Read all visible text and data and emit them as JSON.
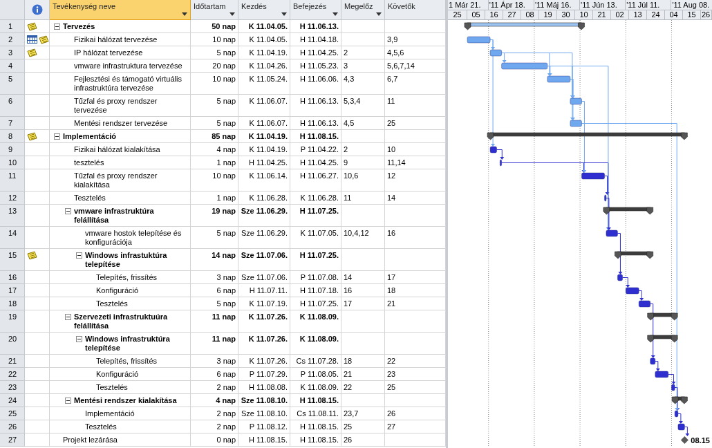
{
  "columns": [
    {
      "label": "Tevékenység neve",
      "selected": true,
      "menu": true
    },
    {
      "label": "Időtartam",
      "selected": false,
      "menu": true
    },
    {
      "label": "Kezdés",
      "selected": false,
      "menu": true
    },
    {
      "label": "Befejezés",
      "selected": false,
      "menu": true
    },
    {
      "label": "Megelőz",
      "selected": false,
      "menu": true
    },
    {
      "label": "Követők",
      "selected": false,
      "menu": false
    }
  ],
  "timescale": {
    "major": [
      "1 Már 21.",
      "'11 Ápr 18.",
      "'11 Máj 16.",
      "'11 Jún 13.",
      "'11 Júl 11.",
      "'11 Aug 08."
    ],
    "minor": [
      "25",
      "05",
      "16",
      "27",
      "08",
      "19",
      "30",
      "10",
      "21",
      "02",
      "13",
      "24",
      "04",
      "15",
      "26"
    ]
  },
  "tasks": [
    {
      "id": "1",
      "kind": "summary",
      "expanded": true,
      "indicators": [
        {
          "kind": "note"
        }
      ],
      "name": "Tervezés",
      "duration": "50 nap",
      "start": "K 11.04.05.",
      "finish": "H 11.06.13.",
      "color": "#9cc4f2",
      "children": [
        {
          "id": "2",
          "kind": "task",
          "indicators": [
            {
              "kind": "calendar"
            },
            {
              "kind": "note"
            }
          ],
          "name": "Fizikai hálózat tervezése",
          "duration": "10 nap",
          "start": "K 11.04.05.",
          "finish": "H 11.04.18.",
          "successors": "3,9",
          "color": "#6fa8ef"
        },
        {
          "id": "3",
          "kind": "task",
          "indicators": [
            {
              "kind": "note"
            }
          ],
          "name": "IP hálózat tervezése",
          "duration": "5 nap",
          "start": "K 11.04.19.",
          "finish": "H 11.04.25.",
          "predecessors": "2",
          "successors": "4,5,6",
          "color": "#6fa8ef"
        },
        {
          "id": "4",
          "kind": "task",
          "name": "vmware infrastruktura tervezése",
          "duration": "20 nap",
          "start": "K 11.04.26.",
          "finish": "H 11.05.23.",
          "predecessors": "3",
          "successors": "5,6,7,14",
          "color": "#6fa8ef"
        },
        {
          "id": "5",
          "kind": "task",
          "name": "Fejlesztési és támogató virtuális infrastruktúra tervezése",
          "duration": "10 nap",
          "start": "K 11.05.24.",
          "finish": "H 11.06.06.",
          "predecessors": "4,3",
          "successors": "6,7",
          "color": "#6fa8ef"
        },
        {
          "id": "6",
          "kind": "task",
          "name": "Tűzfal és proxy rendszer tervezése",
          "duration": "5 nap",
          "start": "K 11.06.07.",
          "finish": "H 11.06.13.",
          "predecessors": "5,3,4",
          "successors": "11",
          "color": "#6fa8ef"
        },
        {
          "id": "7",
          "kind": "task",
          "name": "Mentési rendszer tervezése",
          "duration": "5 nap",
          "start": "K 11.06.07.",
          "finish": "H 11.06.13.",
          "predecessors": "4,5",
          "successors": "25",
          "color": "#6fa8ef"
        }
      ]
    },
    {
      "id": "8",
      "kind": "summary",
      "expanded": true,
      "indicators": [
        {
          "kind": "note"
        }
      ],
      "name": "Implementáció",
      "duration": "85 nap",
      "start": "K 11.04.19.",
      "finish": "H 11.08.15.",
      "color": "#3c3c3c",
      "children": [
        {
          "id": "9",
          "kind": "task",
          "name": "Fizikai hálózat kialakítása",
          "duration": "4 nap",
          "start": "K 11.04.19.",
          "finish": "P 11.04.22.",
          "predecessors": "2",
          "successors": "10",
          "color": "#2f2fd0"
        },
        {
          "id": "10",
          "kind": "task",
          "name": "tesztelés",
          "duration": "1 nap",
          "start": "H 11.04.25.",
          "finish": "H 11.04.25.",
          "predecessors": "9",
          "successors": "11,14",
          "color": "#2f2fd0"
        },
        {
          "id": "11",
          "kind": "task",
          "name": "Tűzfal és proxy rendszer kialakítása",
          "duration": "10 nap",
          "start": "K 11.06.14.",
          "finish": "H 11.06.27.",
          "predecessors": "10,6",
          "successors": "12",
          "color": "#2f2fd0"
        },
        {
          "id": "12",
          "kind": "task",
          "name": "Tesztelés",
          "duration": "1 nap",
          "start": "K 11.06.28.",
          "finish": "K 11.06.28.",
          "predecessors": "11",
          "successors": "14",
          "color": "#2f2fd0"
        },
        {
          "id": "13",
          "kind": "summary",
          "expanded": true,
          "name": "vmware infrastruktúra felállítása",
          "duration": "19 nap",
          "start": "Sze 11.06.29.",
          "finish": "H 11.07.25.",
          "color": "#3c3c3c",
          "children": [
            {
              "id": "14",
              "kind": "task",
              "name": "vmware hostok telepítése és konfigurációja",
              "duration": "5 nap",
              "start": "Sze 11.06.29.",
              "finish": "K 11.07.05.",
              "predecessors": "10,4,12",
              "successors": "16",
              "color": "#2f2fd0"
            },
            {
              "id": "15",
              "kind": "summary",
              "expanded": true,
              "indicators": [
                {
                  "kind": "note"
                }
              ],
              "name": "Windows infrastuktúra telepítése",
              "duration": "14 nap",
              "start": "Sze 11.07.06.",
              "finish": "H 11.07.25.",
              "color": "#3c3c3c",
              "children": [
                {
                  "id": "16",
                  "kind": "task",
                  "name": "Telepítés, frissítés",
                  "duration": "3 nap",
                  "start": "Sze 11.07.06.",
                  "finish": "P 11.07.08.",
                  "predecessors": "14",
                  "successors": "17",
                  "color": "#2f2fd0"
                },
                {
                  "id": "17",
                  "kind": "task",
                  "name": "Konfiguráció",
                  "duration": "6 nap",
                  "start": "H 11.07.11.",
                  "finish": "H 11.07.18.",
                  "predecessors": "16",
                  "successors": "18",
                  "color": "#2f2fd0"
                },
                {
                  "id": "18",
                  "kind": "task",
                  "name": "Tesztelés",
                  "duration": "5 nap",
                  "start": "K 11.07.19.",
                  "finish": "H 11.07.25.",
                  "predecessors": "17",
                  "successors": "21",
                  "color": "#2f2fd0"
                }
              ]
            }
          ]
        },
        {
          "id": "19",
          "kind": "summary",
          "expanded": true,
          "name": "Szervezeti infrastruktuúra felállítása",
          "duration": "11 nap",
          "start": "K 11.07.26.",
          "finish": "K 11.08.09.",
          "color": "#3c3c3c",
          "children": [
            {
              "id": "20",
              "kind": "summary",
              "expanded": true,
              "name": "Windows infrastruktúra telepítése",
              "duration": "11 nap",
              "start": "K 11.07.26.",
              "finish": "K 11.08.09.",
              "color": "#3c3c3c",
              "children": [
                {
                  "id": "21",
                  "kind": "task",
                  "name": "Telepítés, frissítés",
                  "duration": "3 nap",
                  "start": "K 11.07.26.",
                  "finish": "Cs 11.07.28.",
                  "predecessors": "18",
                  "successors": "22",
                  "color": "#2f2fd0"
                },
                {
                  "id": "22",
                  "kind": "task",
                  "name": "Konfiguráció",
                  "duration": "6 nap",
                  "start": "P 11.07.29.",
                  "finish": "P 11.08.05.",
                  "predecessors": "21",
                  "successors": "23",
                  "color": "#2f2fd0"
                },
                {
                  "id": "23",
                  "kind": "task",
                  "name": "Tesztelés",
                  "duration": "2 nap",
                  "start": "H 11.08.08.",
                  "finish": "K 11.08.09.",
                  "predecessors": "22",
                  "successors": "25",
                  "color": "#2f2fd0"
                }
              ]
            }
          ]
        },
        {
          "id": "24",
          "kind": "summary",
          "expanded": true,
          "name": "Mentési rendszer kialakítása",
          "duration": "4 nap",
          "start": "Sze 11.08.10.",
          "finish": "H 11.08.15.",
          "color": "#3c3c3c",
          "children": [
            {
              "id": "25",
              "kind": "task",
              "name": "Implementáció",
              "duration": "2 nap",
              "start": "Sze 11.08.10.",
              "finish": "Cs 11.08.11.",
              "predecessors": "23,7",
              "successors": "26",
              "color": "#2f2fd0"
            },
            {
              "id": "26",
              "kind": "task",
              "name": "Tesztelés",
              "duration": "2 nap",
              "start": "P 11.08.12.",
              "finish": "H 11.08.15.",
              "predecessors": "25",
              "successors": "27",
              "color": "#2f2fd0"
            }
          ]
        }
      ]
    },
    {
      "id": "27",
      "kind": "milestone",
      "name": "Projekt lezárása",
      "duration": "0 nap",
      "start": "H 11.08.15.",
      "finish": "H 11.08.15.",
      "predecessors": "26",
      "label": "08.15",
      "color": "#5a5a5a"
    }
  ]
}
